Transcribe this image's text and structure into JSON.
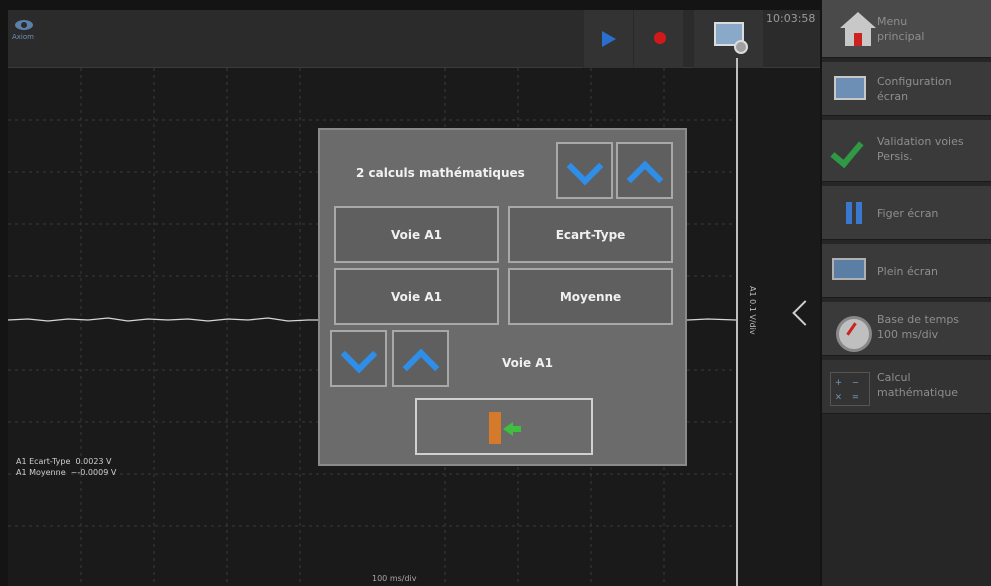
{
  "topbar": {
    "logo_text": "Axiom",
    "clock": "10:03:58"
  },
  "graph": {
    "scale_label": "A1 0.1 V/div",
    "measurements": "A1 Ecart-Type  0.0023 V\nA1 Moyenne  ~-0.0009 V",
    "x_label": "100 ms/div"
  },
  "menu": {
    "items": [
      {
        "label": "Menu\nprincipal",
        "icon": "home-icon"
      },
      {
        "label": "Configuration\nécran",
        "icon": "monitor-icon"
      },
      {
        "label": "Validation voies\nPersis.",
        "icon": "check-icon"
      },
      {
        "label": "Figer écran",
        "icon": "pause-icon"
      },
      {
        "label": "Plein écran",
        "icon": "fullscreen-icon"
      },
      {
        "label": "Base de temps\n100 ms/div",
        "icon": "gauge-icon"
      },
      {
        "label": "Calcul\nmathématique",
        "icon": "calc-icon"
      }
    ]
  },
  "dialog": {
    "title": "2 calculs mathématiques",
    "rows": [
      {
        "source": "Voie A1",
        "operation": "Ecart-Type"
      },
      {
        "source": "Voie A1",
        "operation": "Moyenne"
      }
    ],
    "selected_channel": "Voie A1"
  }
}
